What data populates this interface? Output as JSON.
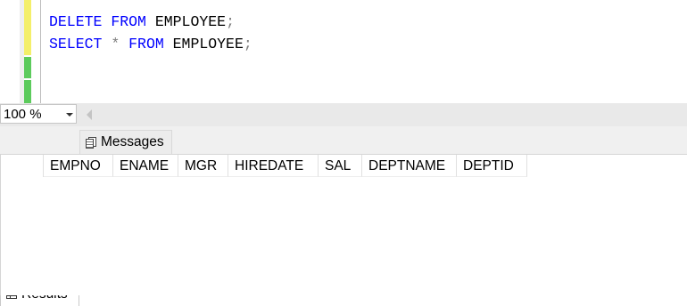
{
  "editor": {
    "lines": [
      {
        "kw1": "DELETE",
        "kw2": "FROM",
        "rest": " EMPLOYEE",
        "end": ";"
      },
      {
        "kw1": "SELECT",
        "star": "*",
        "kw2": "FROM",
        "rest": " EMPLOYEE",
        "end": ";"
      }
    ]
  },
  "zoom": {
    "value": "100 %"
  },
  "tabs": {
    "results_label": "Results",
    "messages_label": "Messages"
  },
  "grid": {
    "columns": [
      "EMPNO",
      "ENAME",
      "MGR",
      "HIREDATE",
      "SAL",
      "DEPTNAME",
      "DEPTID"
    ]
  },
  "colors": {
    "keyword": "#0000ff",
    "operator": "#808080",
    "changed_unsaved": "#f4ef6a",
    "changed_saved": "#5ccb5c"
  }
}
